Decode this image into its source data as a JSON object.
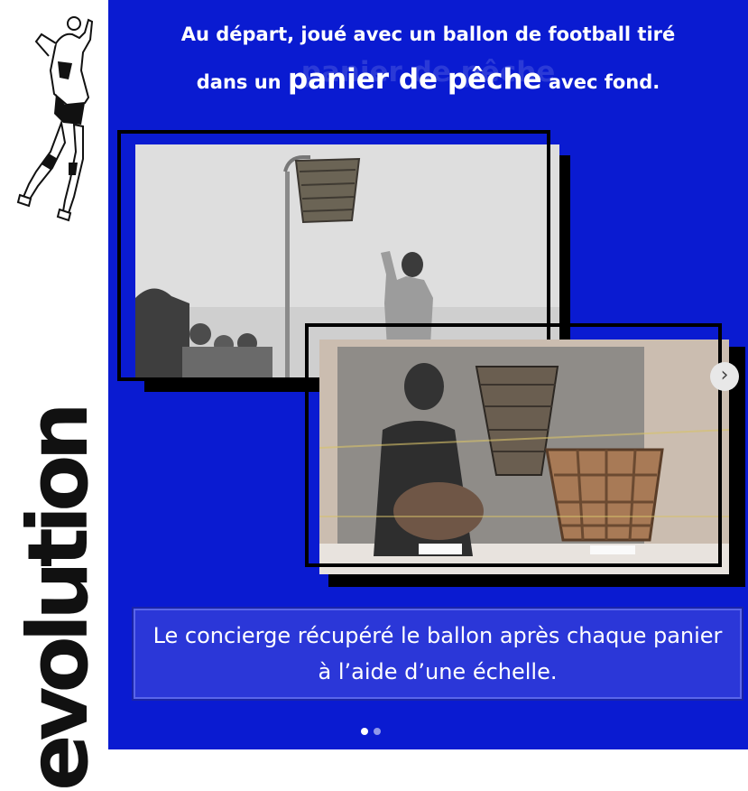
{
  "sidebar": {
    "vertical_word": "evolution"
  },
  "headline": {
    "line1": "Au départ, joué avec un ballon de football tiré",
    "line2_prefix": "dans un ",
    "line2_emphasis": "panier de pêche",
    "line2_suffix": " avec fond.",
    "ghost_text": "panier de pêche"
  },
  "caption": {
    "text": "Le concierge récupéré le ballon après chaque panier à l’aide d’une échelle."
  },
  "carousel": {
    "next_icon": "›",
    "dot_count": 2,
    "active_index": 0
  },
  "colors": {
    "panel": "#0a1bd1",
    "caption_bg": "#2b37d8",
    "sidebar": "#ffffff"
  }
}
